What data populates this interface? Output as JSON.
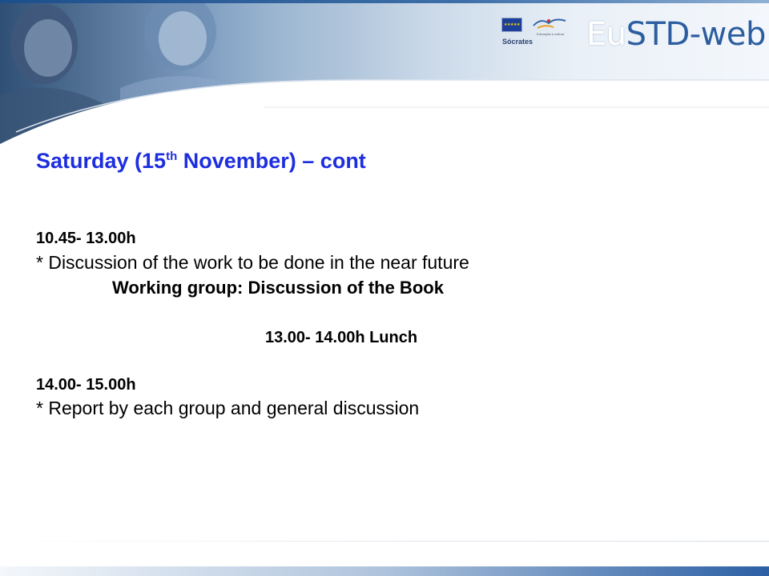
{
  "header": {
    "brand_eu": "Eu",
    "brand_rest": "STD-web",
    "socrates_label": "Sócrates",
    "edu_label": "Educação e cultura"
  },
  "slide": {
    "title_main": "Saturday (15",
    "title_sup": "th",
    "title_rest": " November) – cont",
    "session1_time": "10.45- 13.00h",
    "session1_item": "* Discussion of the work to be done in the near future",
    "session1_group": "Working group: Discussion of the Book",
    "lunch": "13.00- 14.00h Lunch",
    "session2_time": "14.00- 15.00h",
    "session2_item": "* Report by each group and general discussion"
  },
  "colors": {
    "title": "#1d2ee0",
    "brand_blue": "#2c5d9f",
    "header_blue": "#5f84ad"
  }
}
